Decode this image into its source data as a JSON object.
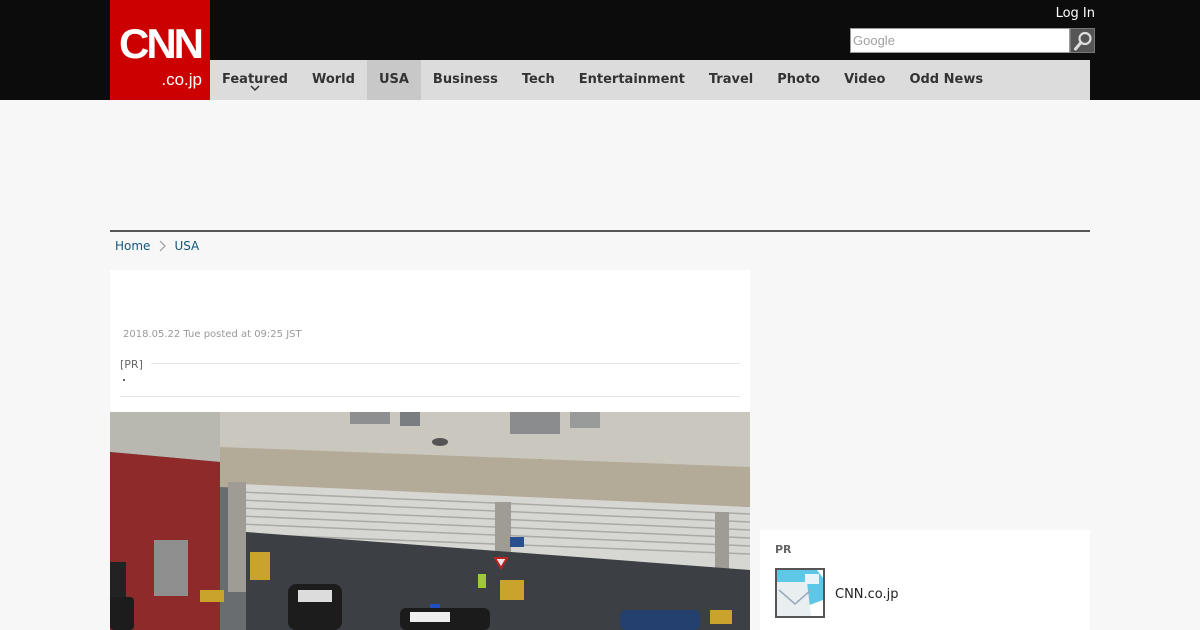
{
  "header": {
    "logo_main": "CNN",
    "logo_sub": ".co.jp",
    "login_label": "Log In",
    "search_placeholder": "Google"
  },
  "nav": {
    "items": [
      {
        "label": "Featured",
        "dropdown": true,
        "active": false
      },
      {
        "label": "World",
        "dropdown": false,
        "active": false
      },
      {
        "label": "USA",
        "dropdown": false,
        "active": true
      },
      {
        "label": "Business",
        "dropdown": false,
        "active": false
      },
      {
        "label": "Tech",
        "dropdown": false,
        "active": false
      },
      {
        "label": "Entertainment",
        "dropdown": false,
        "active": false
      },
      {
        "label": "Travel",
        "dropdown": false,
        "active": false
      },
      {
        "label": "Photo",
        "dropdown": false,
        "active": false
      },
      {
        "label": "Video",
        "dropdown": false,
        "active": false
      },
      {
        "label": "Odd News",
        "dropdown": false,
        "active": false
      }
    ]
  },
  "breadcrumb": {
    "items": [
      "Home",
      "USA"
    ]
  },
  "article": {
    "posted": "2018.05.22 Tue posted at 09:25 JST",
    "pr_label": "[PR]"
  },
  "sidebar": {
    "pr_title": "PR",
    "pr_item_name": "CNN.co.jp"
  },
  "colors": {
    "brand_red": "#cc0000",
    "topbar": "#0c0c0c",
    "nav_bg": "#dcdcdc",
    "link": "#14557a"
  }
}
